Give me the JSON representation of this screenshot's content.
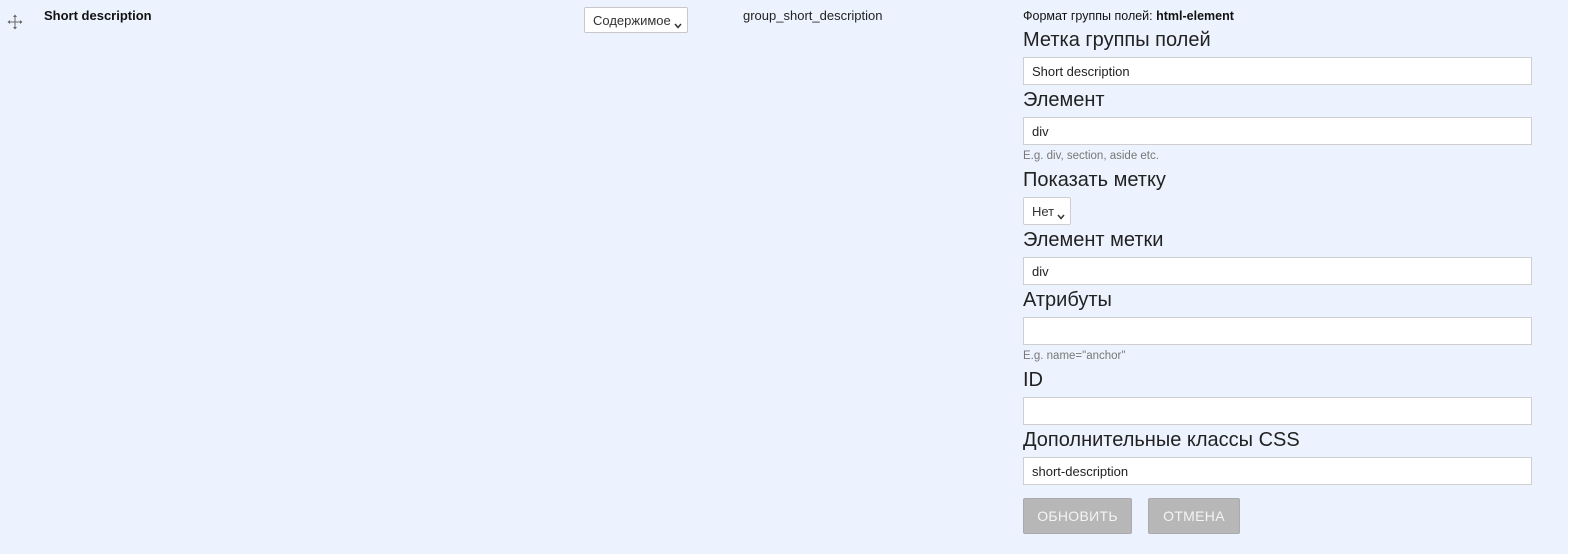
{
  "row": {
    "label": "Short description",
    "region_select_value": "Содержимое",
    "machine_name": "group_short_description"
  },
  "settings": {
    "format_prefix": "Формат группы полей:",
    "format_value": "html-element",
    "group_label": {
      "title": "Метка группы полей",
      "value": "Short description"
    },
    "element": {
      "title": "Элемент",
      "value": "div",
      "hint": "E.g. div, section, aside etc."
    },
    "show_label": {
      "title": "Показать метку",
      "value": "Нет"
    },
    "label_element": {
      "title": "Элемент метки",
      "value": "div"
    },
    "attributes": {
      "title": "Атрибуты",
      "value": "",
      "hint": "E.g. name=\"anchor\""
    },
    "id": {
      "title": "ID",
      "value": ""
    },
    "css_classes": {
      "title": "Дополнительные классы CSS",
      "value": "short-description"
    },
    "buttons": {
      "update": "ОБНОВИТЬ",
      "cancel": "ОТМЕНА"
    }
  },
  "icons": {
    "drag": "move-cross-icon",
    "chevron": "chevron-down-icon"
  },
  "colors": {
    "row_background": "#edf3fe",
    "button_background": "#b7b7b7",
    "button_text": "#f4f4f4",
    "hint_text": "#777777"
  }
}
